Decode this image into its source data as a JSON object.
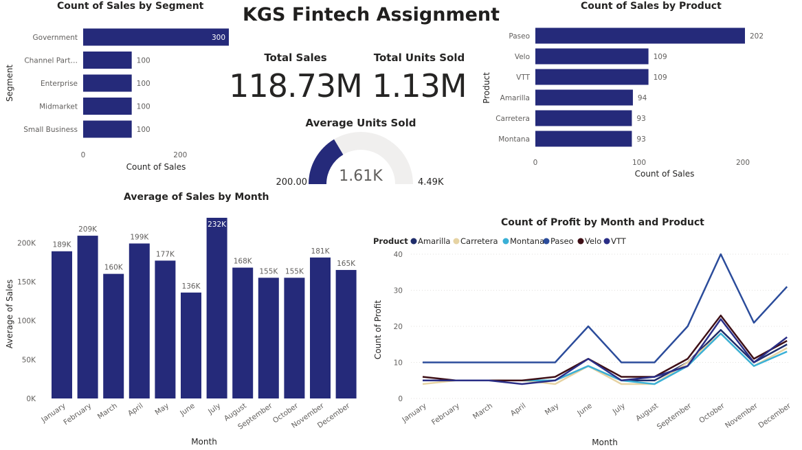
{
  "report_title": "KGS Fintech Assignment",
  "colors": {
    "bar": "#252a7a",
    "text": "#252423",
    "axis": "#605e5c",
    "grid": "#e1dfdd",
    "gauge_bg": "#f0efee"
  },
  "cards": {
    "total_sales": {
      "label": "Total Sales",
      "value": "118.73M"
    },
    "total_units": {
      "label": "Total Units Sold",
      "value": "1.13M"
    }
  },
  "gauge": {
    "title": "Average Units Sold",
    "min_label": "200.00",
    "max_label": "4.49K",
    "value_label": "1.61K",
    "min": 200,
    "max": 4490,
    "value": 1610
  },
  "chart_data": [
    {
      "id": "segment",
      "type": "bar",
      "orientation": "horizontal",
      "title": "Count of Sales by Segment",
      "xlabel": "Count of Sales",
      "ylabel": "Segment",
      "categories": [
        "Government",
        "Channel Part…",
        "Enterprise",
        "Midmarket",
        "Small Business"
      ],
      "values": [
        300,
        100,
        100,
        100,
        100
      ],
      "data_labels": [
        "300",
        "100",
        "100",
        "100",
        "100"
      ],
      "xlim": [
        0,
        300
      ],
      "xticks": [
        0,
        200
      ],
      "xtick_labels": [
        "0",
        "200"
      ]
    },
    {
      "id": "product",
      "type": "bar",
      "orientation": "horizontal",
      "title": "Count of Sales by Product",
      "xlabel": "Count of Sales",
      "ylabel": "Product",
      "categories": [
        "Paseo",
        "Velo",
        "VTT",
        "Amarilla",
        "Carretera",
        "Montana"
      ],
      "values": [
        202,
        109,
        109,
        94,
        93,
        93
      ],
      "data_labels": [
        "202",
        "109",
        "109",
        "94",
        "93",
        "93"
      ],
      "xlim": [
        0,
        202
      ],
      "xticks": [
        0,
        100,
        200
      ],
      "xtick_labels": [
        "0",
        "100",
        "200"
      ]
    },
    {
      "id": "month_sales",
      "type": "bar",
      "orientation": "vertical",
      "title": "Average of Sales by Month",
      "xlabel": "Month",
      "ylabel": "Average of Sales",
      "categories": [
        "January",
        "February",
        "March",
        "April",
        "May",
        "June",
        "July",
        "August",
        "September",
        "October",
        "November",
        "December"
      ],
      "values": [
        189000,
        209000,
        160000,
        199000,
        177000,
        136000,
        232000,
        168000,
        155000,
        155000,
        181000,
        165000
      ],
      "data_labels": [
        "189K",
        "209K",
        "160K",
        "199K",
        "177K",
        "136K",
        "232K",
        "168K",
        "155K",
        "155K",
        "181K",
        "165K"
      ],
      "ylim": [
        0,
        232000
      ],
      "yticks": [
        0,
        50000,
        100000,
        150000,
        200000
      ],
      "ytick_labels": [
        "0K",
        "50K",
        "100K",
        "150K",
        "200K"
      ]
    },
    {
      "id": "profit_lines",
      "type": "line",
      "title": "Count of Profit by Month and Product",
      "xlabel": "Month",
      "ylabel": "Count of Profit",
      "legend_title": "Product",
      "legend_position": "top-left",
      "x": [
        "January",
        "February",
        "March",
        "April",
        "May",
        "June",
        "July",
        "August",
        "September",
        "October",
        "November",
        "December"
      ],
      "ylim": [
        0,
        40
      ],
      "yticks": [
        0,
        10,
        20,
        30,
        40
      ],
      "ytick_labels": [
        "0",
        "10",
        "20",
        "30",
        "40"
      ],
      "grid": true,
      "series": [
        {
          "name": "Amarilla",
          "color": "#1f2d6b",
          "values": [
            5,
            5,
            5,
            5,
            5,
            9,
            5,
            5,
            10,
            19,
            10,
            15
          ]
        },
        {
          "name": "Carretera",
          "color": "#e6d3a3",
          "values": [
            4,
            5,
            5,
            5,
            4,
            9,
            4,
            4,
            10,
            18,
            9,
            14
          ]
        },
        {
          "name": "Montana",
          "color": "#3ab0d6",
          "values": [
            5,
            5,
            5,
            5,
            5,
            9,
            5,
            4,
            9,
            18,
            9,
            13
          ]
        },
        {
          "name": "Paseo",
          "color": "#2b4c9b",
          "values": [
            10,
            10,
            10,
            10,
            10,
            20,
            10,
            10,
            20,
            40,
            21,
            31
          ]
        },
        {
          "name": "Velo",
          "color": "#3e0f16",
          "values": [
            6,
            5,
            5,
            5,
            6,
            11,
            6,
            6,
            11,
            23,
            11,
            16
          ]
        },
        {
          "name": "VTT",
          "color": "#2a2e86",
          "values": [
            5,
            5,
            5,
            4,
            5,
            11,
            5,
            6,
            9,
            22,
            10,
            17
          ]
        }
      ]
    }
  ]
}
